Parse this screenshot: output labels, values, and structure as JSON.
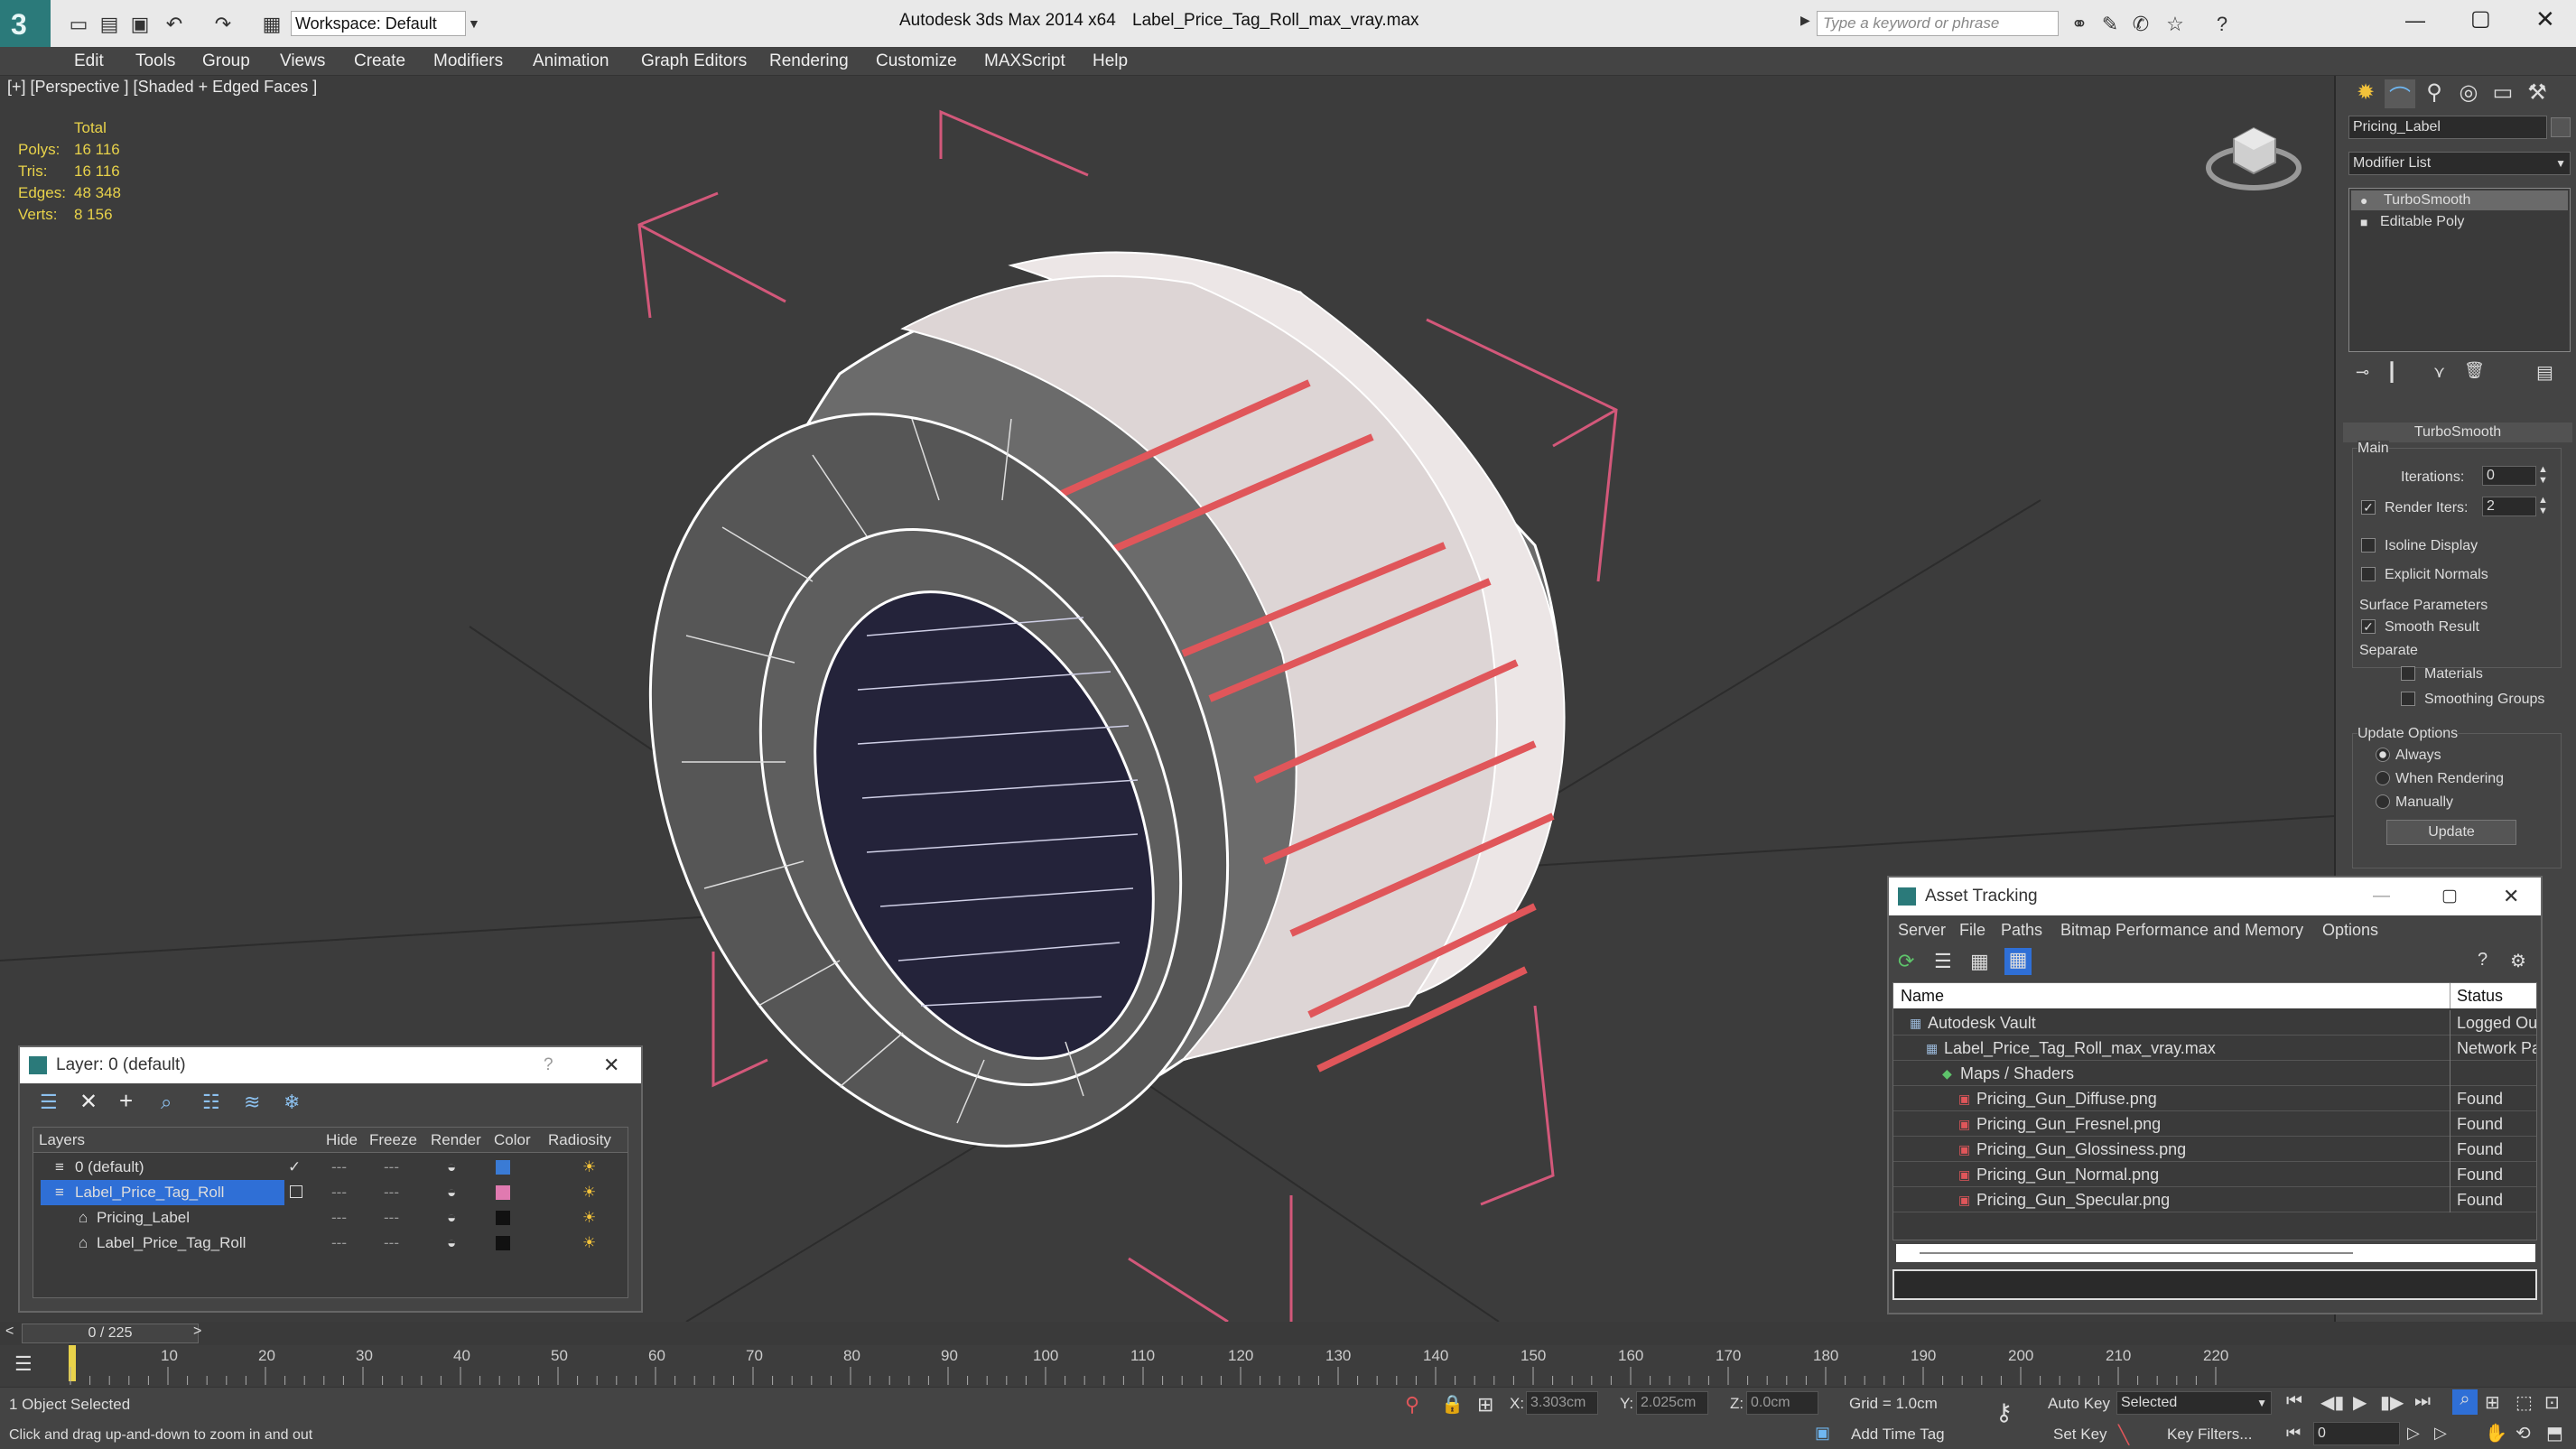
{
  "titlebar": {
    "workspace_label": "Workspace: Default",
    "app_title": "Autodesk 3ds Max  2014 x64",
    "file_title": "Label_Price_Tag_Roll_max_vray.max",
    "search_placeholder": "Type a keyword or phrase"
  },
  "menu": [
    "Edit",
    "Tools",
    "Group",
    "Views",
    "Create",
    "Modifiers",
    "Animation",
    "Graph Editors",
    "Rendering",
    "Customize",
    "MAXScript",
    "Help"
  ],
  "viewport": {
    "label": "[+] [Perspective ] [Shaded + Edged Faces ]",
    "stats_header": "Total",
    "stats": [
      {
        "label": "Polys:",
        "value": "16 116"
      },
      {
        "label": "Tris:",
        "value": "16 116"
      },
      {
        "label": "Edges:",
        "value": "48 348"
      },
      {
        "label": "Verts:",
        "value": "8 156"
      }
    ]
  },
  "command_panel": {
    "object_name": "Pricing_Label",
    "modifier_list": "Modifier List",
    "stack": [
      "TurboSmooth",
      "Editable Poly"
    ],
    "rollout_title": "TurboSmooth",
    "main_group": "Main",
    "iterations_label": "Iterations:",
    "iterations_value": "0",
    "render_iters_label": "Render Iters:",
    "render_iters_value": "2",
    "isoline_label": "Isoline Display",
    "explicit_normals_label": "Explicit Normals",
    "surface_params_label": "Surface Parameters",
    "smooth_result_label": "Smooth Result",
    "separate_label": "Separate",
    "materials_label": "Materials",
    "smoothing_groups_label": "Smoothing Groups",
    "update_options_label": "Update Options",
    "always_label": "Always",
    "when_rendering_label": "When Rendering",
    "manually_label": "Manually",
    "update_button": "Update"
  },
  "layer_dialog": {
    "title": "Layer: 0 (default)",
    "help_glyph": "?",
    "columns": [
      "Layers",
      "Hide",
      "Freeze",
      "Render",
      "Color",
      "Radiosity"
    ],
    "rows": [
      {
        "name": "0 (default)",
        "color": "#3a7bd5",
        "selected": false,
        "indent": 0
      },
      {
        "name": "Label_Price_Tag_Roll",
        "color": "#e07ab0",
        "selected": true,
        "indent": 0
      },
      {
        "name": "Pricing_Label",
        "color": "#111111",
        "selected": false,
        "indent": 1
      },
      {
        "name": "Label_Price_Tag_Roll",
        "color": "#111111",
        "selected": false,
        "indent": 1
      }
    ]
  },
  "asset_tracking": {
    "title": "Asset Tracking",
    "menu": [
      "Server",
      "File",
      "Paths",
      "Bitmap Performance and Memory",
      "Options"
    ],
    "col_name": "Name",
    "col_status": "Status",
    "rows": [
      {
        "name": "Autodesk Vault",
        "status": "Logged Ou",
        "indent": 1
      },
      {
        "name": "Label_Price_Tag_Roll_max_vray.max",
        "status": "Network Pa",
        "indent": 2
      },
      {
        "name": "Maps / Shaders",
        "status": "",
        "indent": 3
      },
      {
        "name": "Pricing_Gun_Diffuse.png",
        "status": "Found",
        "indent": 4
      },
      {
        "name": "Pricing_Gun_Fresnel.png",
        "status": "Found",
        "indent": 4
      },
      {
        "name": "Pricing_Gun_Glossiness.png",
        "status": "Found",
        "indent": 4
      },
      {
        "name": "Pricing_Gun_Normal.png",
        "status": "Found",
        "indent": 4
      },
      {
        "name": "Pricing_Gun_Specular.png",
        "status": "Found",
        "indent": 4
      }
    ]
  },
  "timeline": {
    "frame_readout": "0 / 225",
    "ticks": [
      "10",
      "20",
      "30",
      "40",
      "50",
      "60",
      "70",
      "80",
      "90",
      "100",
      "110",
      "120",
      "130",
      "140",
      "150",
      "160",
      "170",
      "180",
      "190",
      "200",
      "210",
      "220"
    ]
  },
  "status": {
    "selection": "1 Object Selected",
    "prompt": "Click and drag up-and-down to zoom in and out",
    "x_label": "X:",
    "x_value": "3.303cm",
    "y_label": "Y:",
    "y_value": "2.025cm",
    "z_label": "Z:",
    "z_value": "0.0cm",
    "grid": "Grid = 1.0cm",
    "add_time_tag": "Add Time Tag",
    "auto_key": "Auto Key",
    "set_key": "Set Key",
    "selected_dropdown": "Selected",
    "key_filters": "Key Filters...",
    "frame_field": "0"
  },
  "colors": {
    "accent_blue": "#2f6fd6",
    "wire_white": "#ffffff",
    "label_red": "#e0565a",
    "bbox_pink": "#d3587a",
    "stat_yellow": "#e8d24a"
  }
}
